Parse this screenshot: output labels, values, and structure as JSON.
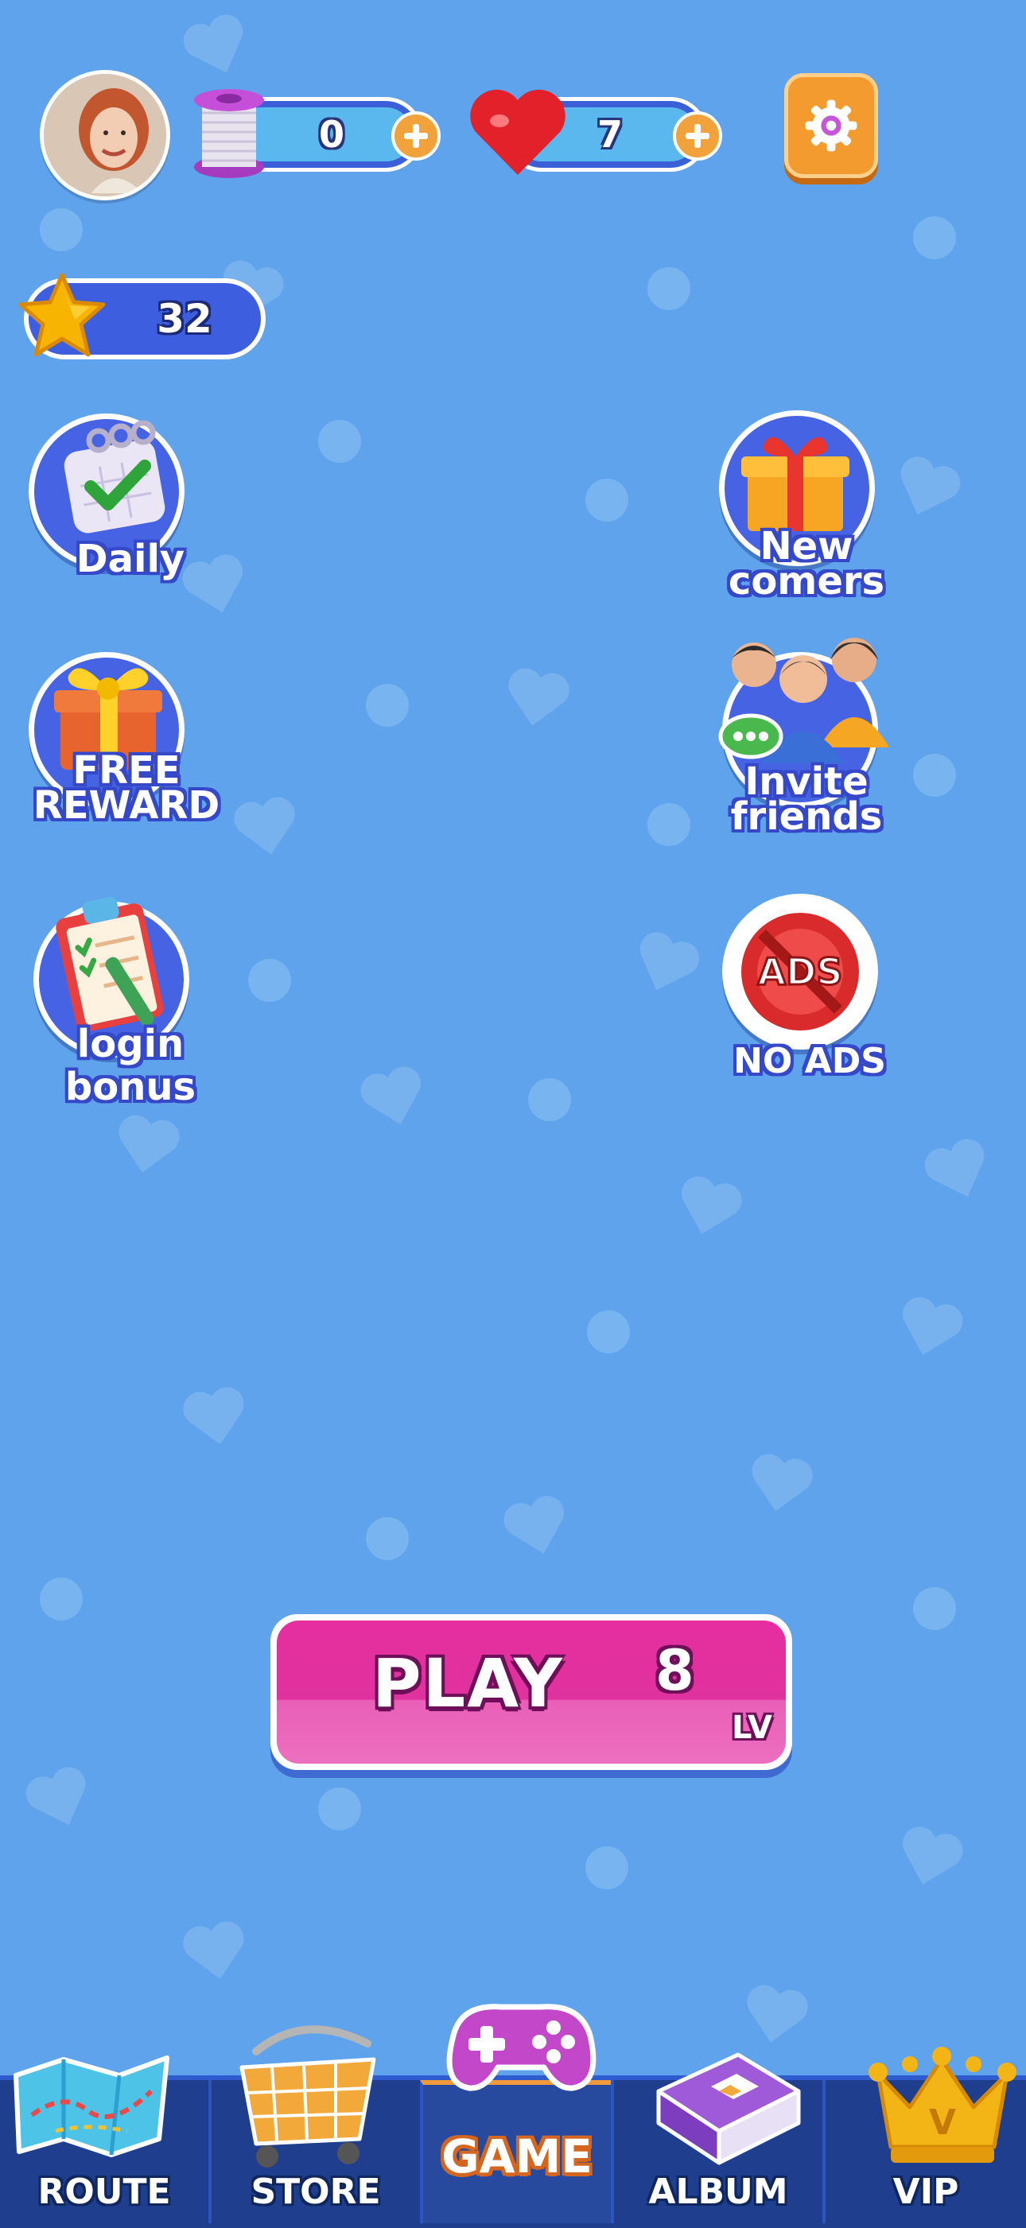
{
  "hud": {
    "spools": "0",
    "lives": "7",
    "stars": "32"
  },
  "side_buttons": {
    "daily": "Daily",
    "new_comers": [
      "New",
      "comers"
    ],
    "free_reward": [
      "FREE",
      "REWARD"
    ],
    "invite_friends": [
      "Invite",
      "friends"
    ],
    "login_bonus": [
      "login",
      "bonus"
    ],
    "no_ads": "NO ADS",
    "ads_badge": "ADS"
  },
  "play": {
    "label": "PLAY",
    "level": "8",
    "level_unit": "LV"
  },
  "nav": {
    "route": "ROUTE",
    "store": "STORE",
    "game": "GAME",
    "album": "ALBUM",
    "vip": "VIP",
    "vip_crown_letter": "V"
  },
  "colors": {
    "background": "#5ea3ec",
    "play_button": "#e0329e",
    "nav_bar": "#1f3e8e",
    "accent_orange": "#f39b2f"
  }
}
